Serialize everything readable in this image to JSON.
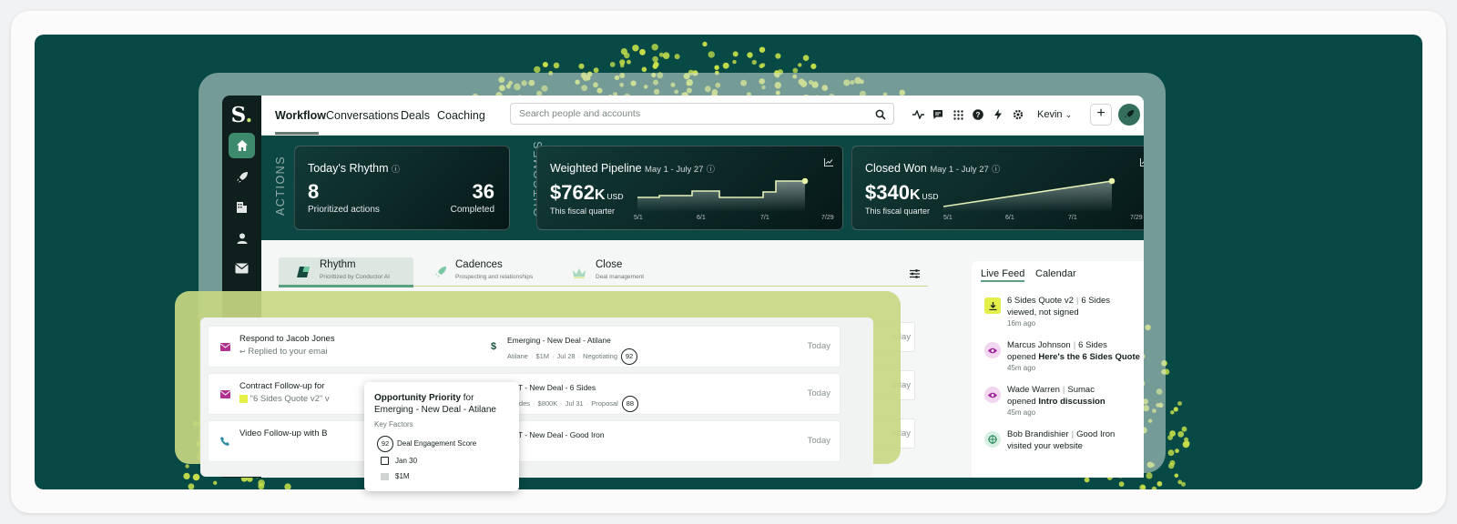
{
  "brand": {
    "logo": "S",
    "logo_dot": ".",
    "accent": "#c6e071",
    "dark": "#0c4743",
    "hero_bg": "#064945"
  },
  "rail": [
    {
      "icon": "home-icon",
      "active": true
    },
    {
      "icon": "rocket-icon",
      "active": false
    },
    {
      "icon": "building-icon",
      "active": false
    },
    {
      "icon": "person-icon",
      "active": false
    },
    {
      "icon": "mail-icon",
      "active": false
    }
  ],
  "nav": {
    "tabs": [
      "Workflow",
      "Conversations",
      "Deals",
      "Coaching"
    ],
    "active": "Workflow"
  },
  "search": {
    "placeholder": "Search people and accounts"
  },
  "user": {
    "name": "Kevin",
    "plus": "+"
  },
  "section_labels": {
    "actions": "ACTIONS",
    "outcomes": "OUTCOMES"
  },
  "rhythm_card": {
    "title": "Today's Rhythm",
    "prioritized_value": "8",
    "prioritized_label": "Prioritized actions",
    "completed_value": "36",
    "completed_label": "Completed"
  },
  "pipeline_card": {
    "title": "Weighted Pipeline",
    "range": "May 1 - July 27",
    "value": "$762",
    "unit": "K",
    "currency": "USD",
    "caption": "This fiscal quarter",
    "axis": [
      "5/1",
      "6/1",
      "7/1",
      "7/29"
    ]
  },
  "won_card": {
    "title": "Closed Won",
    "range": "May 1 - July 27",
    "value": "$340",
    "unit": "K",
    "currency": "USD",
    "caption": "This fiscal quarter",
    "axis": [
      "5/1",
      "6/1",
      "7/1",
      "7/29"
    ]
  },
  "rhythm_tabs": [
    {
      "title": "Rhythm",
      "subtitle": "Prioritized by Conductor AI"
    },
    {
      "title": "Cadences",
      "subtitle": "Prospecting and relationships"
    },
    {
      "title": "Close",
      "subtitle": "Deal management"
    }
  ],
  "ghost_rows": [
    "oday",
    "oday",
    "oday"
  ],
  "tasks": [
    {
      "title": "Respond to Jacob Jones",
      "sub": "Replied to your emai",
      "deal": "Emerging - New Deal - Atilane",
      "account": "Atilane",
      "amount": "$1M",
      "date": "Jul 28",
      "stage": "Negotiating",
      "score": "92",
      "when": "Today"
    },
    {
      "title": "Contract Follow-up for",
      "sub": "\"6 Sides Quote v2\" v",
      "deal": "ENT - New Deal - 6 Sides",
      "account": "6 Sides",
      "amount": "$800K",
      "date": "Jul 31",
      "stage": "Proposal",
      "score": "88",
      "when": "Today"
    },
    {
      "title": "Video Follow-up with B",
      "sub": "",
      "deal": "ENT - New Deal - Good Iron",
      "account": "",
      "amount": "",
      "date": "",
      "stage": "",
      "score": "",
      "when": "Today"
    }
  ],
  "popover": {
    "title_bold": "Opportunity Priority",
    "title_rest": " for Emerging - New Deal - Atilane",
    "key_factors": "Key Factors",
    "score": "92",
    "score_label": "Deal Engagement Score",
    "date": "Jan 30",
    "amount": "$1M"
  },
  "feed": {
    "tabs": [
      "Live Feed",
      "Calendar"
    ],
    "items": [
      {
        "icon": "download-icon",
        "color": "#e5ef4a",
        "a": "6 Sides Quote v2",
        "b": "6 Sides",
        "action": "viewed, not signed",
        "bold": "",
        "time": "16m ago"
      },
      {
        "icon": "eye-icon",
        "color": "#f2d6ef",
        "a": "Marcus Johnson",
        "b": "6 Sides",
        "action": "opened ",
        "bold": "Here's the 6 Sides Quote",
        "time": "45m ago"
      },
      {
        "icon": "eye-icon",
        "color": "#f2d6ef",
        "a": "Wade Warren",
        "b": "Sumac",
        "action": "opened ",
        "bold": "Intro discussion",
        "time": "45m ago"
      },
      {
        "icon": "target-icon",
        "color": "#d7f0e3",
        "a": "Bob Brandishier",
        "b": "Good Iron",
        "action": "visited your website",
        "bold": "",
        "time": ""
      }
    ]
  }
}
